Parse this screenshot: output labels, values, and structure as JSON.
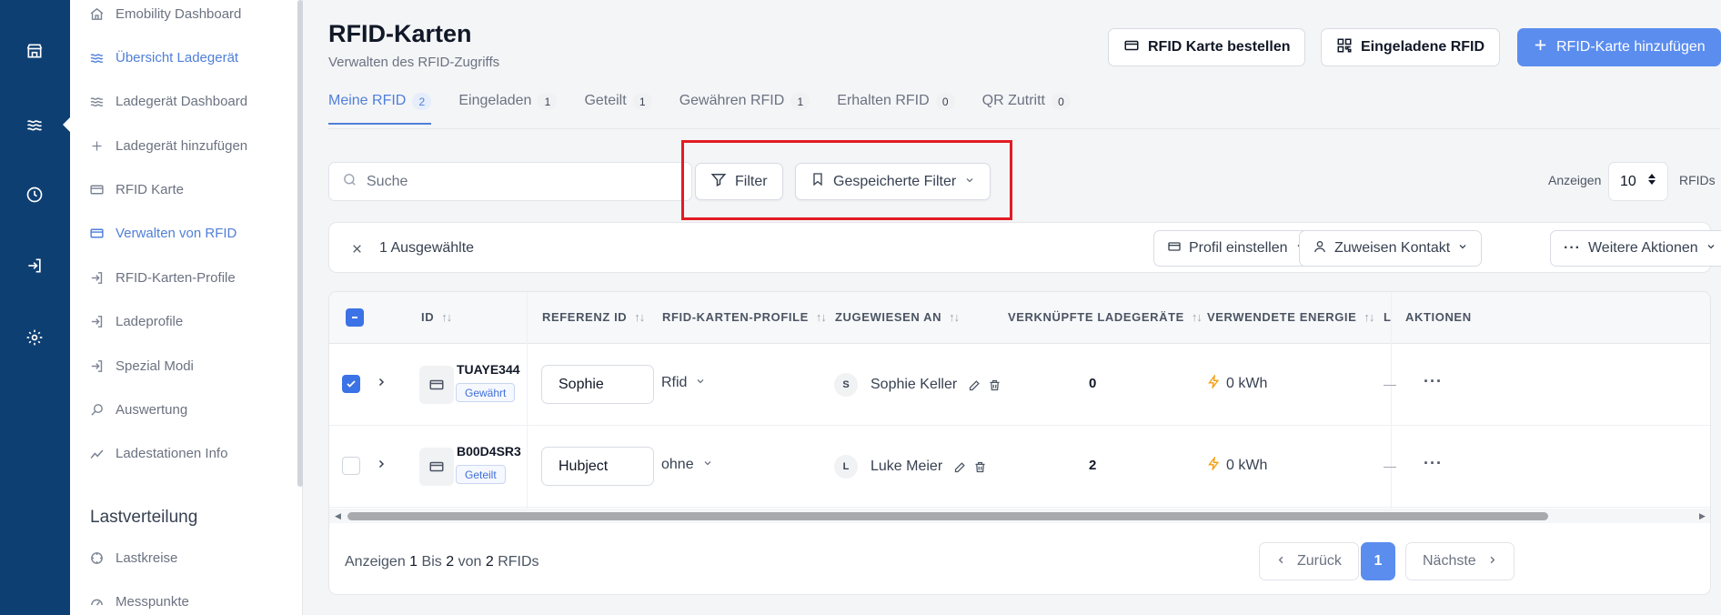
{
  "sidebar": {
    "items": [
      {
        "label": "Emobility Dashboard",
        "icon": "home-icon"
      },
      {
        "label": "Übersicht Ladegerät",
        "icon": "waves-icon",
        "active": true
      },
      {
        "label": "Ladegerät Dashboard",
        "icon": "waves-icon"
      },
      {
        "label": "Ladegerät hinzufügen",
        "icon": "plus-icon"
      },
      {
        "label": "RFID Karte",
        "icon": "card-icon"
      },
      {
        "label": "Verwalten von RFID",
        "icon": "card-icon",
        "active": true
      },
      {
        "label": "RFID-Karten-Profile",
        "icon": "login-icon"
      },
      {
        "label": "Ladeprofile",
        "icon": "login-icon"
      },
      {
        "label": "Spezial Modi",
        "icon": "login-icon"
      },
      {
        "label": "Auswertung",
        "icon": "search-icon"
      },
      {
        "label": "Ladestationen Info",
        "icon": "trend-icon"
      }
    ],
    "section_title": "Lastverteilung",
    "section_items": [
      {
        "label": "Lastkreise",
        "icon": "circle-dashed-icon"
      },
      {
        "label": "Messpunkte",
        "icon": "gauge-icon"
      }
    ]
  },
  "header": {
    "title": "RFID-Karten",
    "subtitle": "Verwalten des RFID-Zugriffs",
    "order_btn": "RFID Karte bestellen",
    "invited_btn": "Eingeladene RFID",
    "add_btn": "RFID-Karte hinzufügen"
  },
  "tabs": [
    {
      "label": "Meine RFID",
      "count": "2",
      "active": true
    },
    {
      "label": "Eingeladen",
      "count": "1"
    },
    {
      "label": "Geteilt",
      "count": "1"
    },
    {
      "label": "Gewähren RFID",
      "count": "1"
    },
    {
      "label": "Erhalten RFID",
      "count": "0"
    },
    {
      "label": "QR Zutritt",
      "count": "0"
    }
  ],
  "toolbar": {
    "search_placeholder": "Suche",
    "filter_label": "Filter",
    "saved_filter_label": "Gespeicherte Filter",
    "show_label": "Anzeigen",
    "page_size": "10",
    "unit_label": "RFIDs"
  },
  "selection": {
    "count_text": "1 Ausgewählte",
    "profile_btn": "Profil einstellen",
    "assign_btn": "Zuweisen Kontakt",
    "more_btn": "Weitere Aktionen"
  },
  "table": {
    "headers": {
      "id": "ID",
      "ref": "REFERENZ ID",
      "profiles": "RFID-KARTEN-PROFILE",
      "assigned": "ZUGEWIESEN AN",
      "chargers": "VERKNÜPFTE LADEGERÄTE",
      "energy": "VERWENDETE ENERGIE",
      "truncated": "L",
      "actions": "AKTIONEN"
    },
    "sort_glyph": "↑↓",
    "rows": [
      {
        "id": "TUAYE344",
        "status": "Gewährt",
        "ref": "Sophie",
        "profile": "Rfid",
        "initial": "S",
        "contact": "Sophie Keller",
        "chargers": "0",
        "energy": "0 kWh",
        "dash": "—",
        "checked": true
      },
      {
        "id": "B00D4SR3",
        "status": "Geteilt",
        "ref": "Hubject",
        "profile": "ohne",
        "initial": "L",
        "contact": "Luke Meier",
        "chargers": "2",
        "energy": "0 kWh",
        "dash": "—",
        "checked": false
      }
    ]
  },
  "footer": {
    "prefix": "Anzeigen",
    "from": "1",
    "mid": "Bis",
    "to": "2",
    "of": "von",
    "total": "2",
    "unit": "RFIDs",
    "prev": "Zurück",
    "page": "1",
    "next": "Nächste"
  },
  "colors": {
    "rail": "#0e3f73",
    "accent": "#5b8def",
    "highlight": "#e31b23"
  }
}
